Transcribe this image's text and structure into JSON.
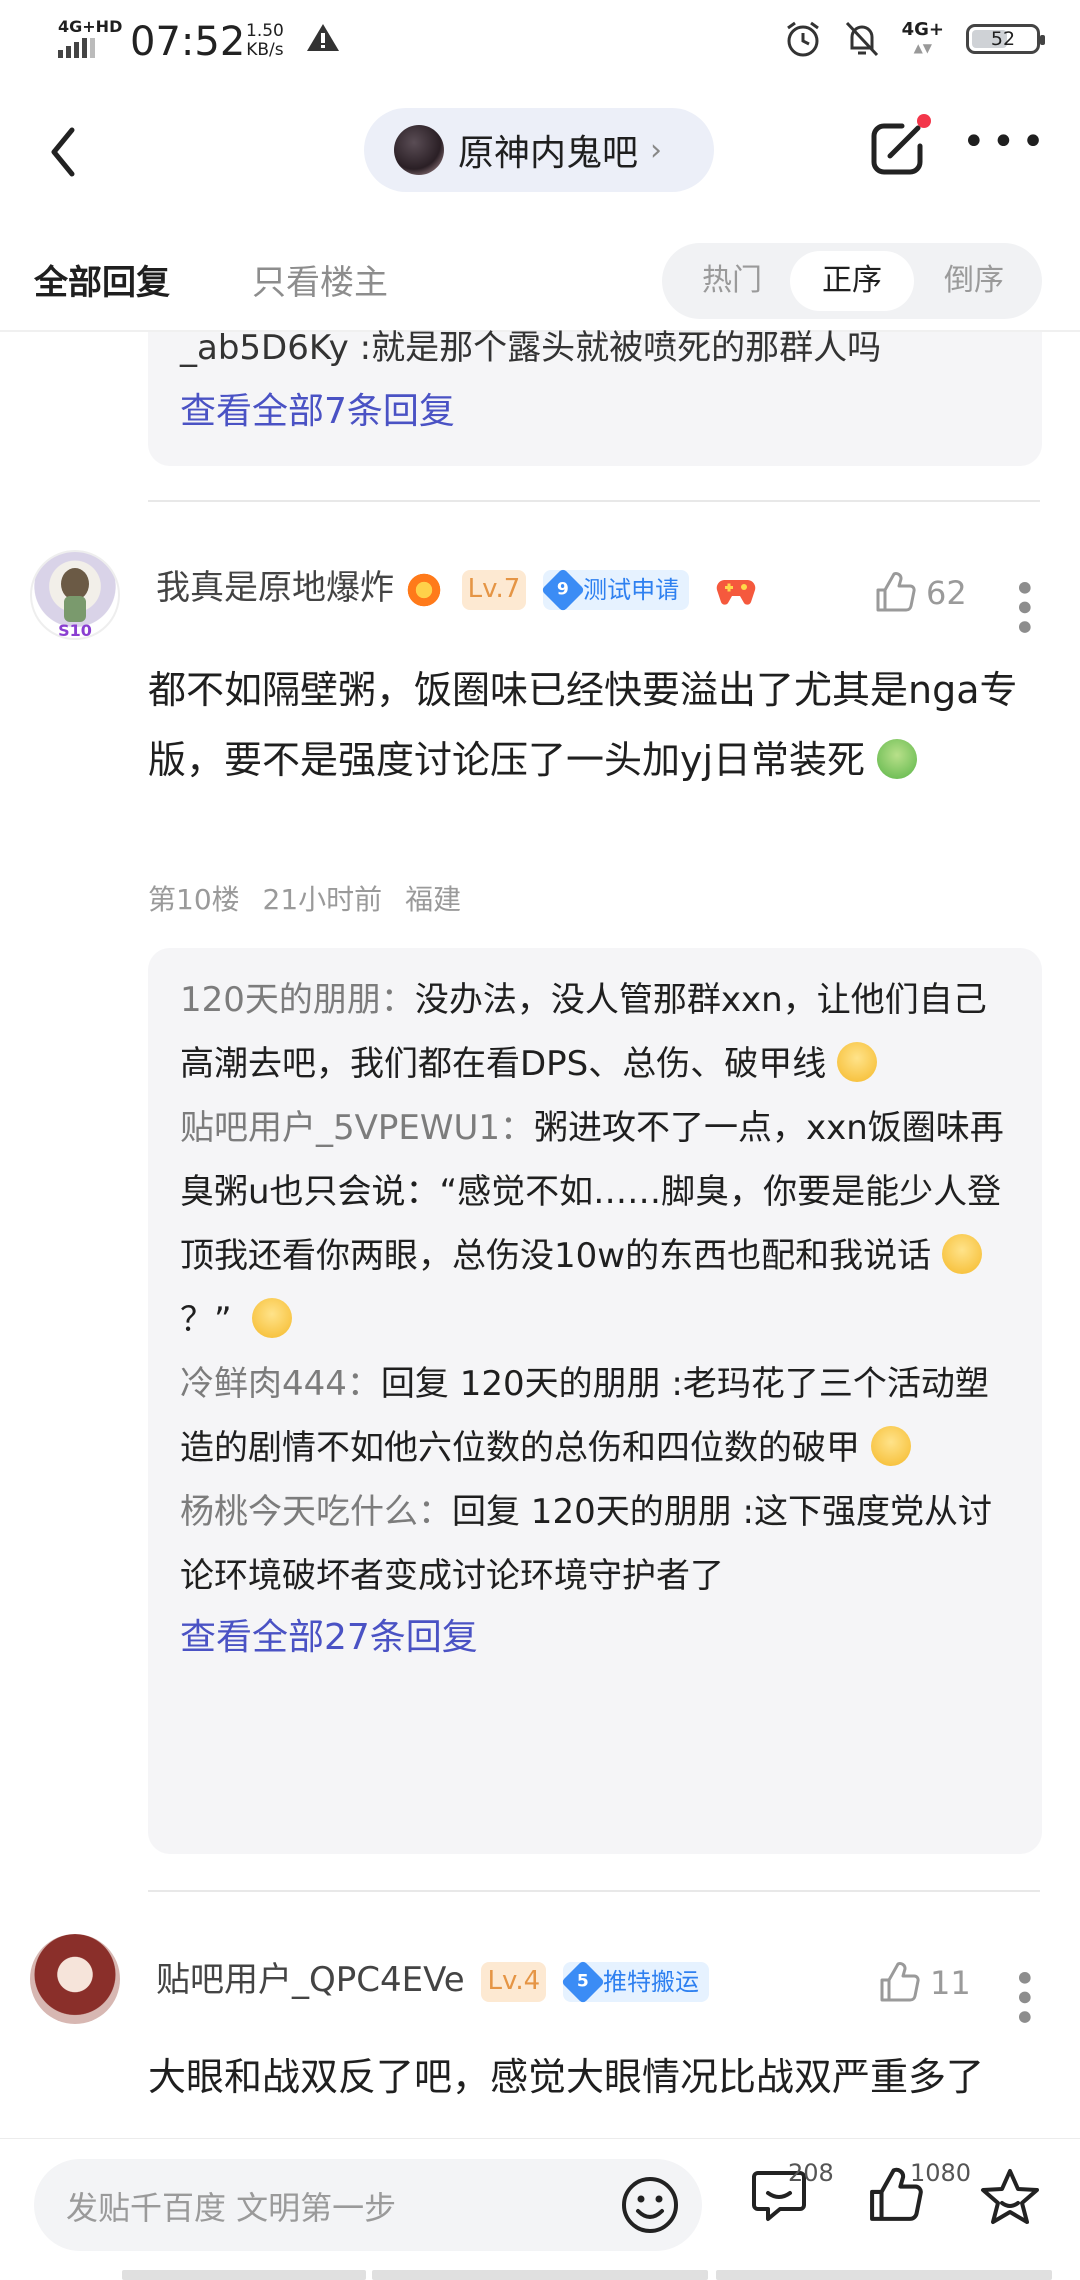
{
  "status": {
    "network": "4G+HD",
    "time": "07:52",
    "rate_value": "1.50",
    "rate_unit": "KB/s",
    "network2": "4G+",
    "battery": "52",
    "battery_level": 0.52
  },
  "header": {
    "forum_name": "原神内鬼吧",
    "forum_chevron": "›"
  },
  "tabs": {
    "all": "全部回复",
    "owner_only": "只看楼主",
    "sort_hot": "热门",
    "sort_asc": "正序",
    "sort_desc": "倒序"
  },
  "prev_block": {
    "reply_text": "_ab5D6Ky :就是那个露头就被喷死的那群人吗",
    "view_all": "查看全部7条回复"
  },
  "post1": {
    "username": "我真是原地爆炸",
    "level": "Lv.7",
    "badge_num": "9",
    "badge_text": "测试申请",
    "likes": "62",
    "avatar_tag": "S10",
    "content": "都不如隔壁粥，饭圈味已经快要溢出了尤其是nga专版，要不是强度讨论压了一头加yj日常装死",
    "floor": "第10楼",
    "time": "21小时前",
    "location": "福建",
    "replies": [
      {
        "user": "120天的朋朋：",
        "text": "没办法，没人管那群xxn，让他们自己高潮去吧，我们都在看DPS、总伤、破甲线"
      },
      {
        "user": "贴吧用户_5VPEWU1：",
        "text": "粥进攻不了一点，xxn饭圈味再臭粥u也只会说：“感觉不如……脚臭，你要是能少人登顶我还看你两眼，总伤没10w的东西也配和我说话",
        "tail": "？”"
      },
      {
        "user": "冷鲜肉444：",
        "text": "回复 120天的朋朋 :老玛花了三个活动塑造的剧情不如他六位数的总伤和四位数的破甲"
      },
      {
        "user": "杨桃今天吃什么：",
        "text": "回复 120天的朋朋 :这下强度党从讨论环境破坏者变成讨论环境守护者了"
      }
    ],
    "view_all": "查看全部27条回复"
  },
  "post2": {
    "username": "贴吧用户_QPC4EVe",
    "level": "Lv.4",
    "badge_num": "5",
    "badge_text": "推特搬运",
    "likes": "11",
    "content": "大眼和战双反了吧，感觉大眼情况比战双严重多了"
  },
  "bottom": {
    "placeholder": "发贴千百度 文明第一步",
    "comments": "208",
    "likes": "1080"
  },
  "colors": {
    "accent": "#4a52c4",
    "badge_blue": "#2e80f0",
    "notif_dot": "#f3364a"
  },
  "icons": [
    "back-icon",
    "chevron-right-icon",
    "compose-icon",
    "more-icon",
    "explosion-icon",
    "gamepad-icon",
    "thumb-up-icon",
    "kebab-icon",
    "smile-icon",
    "comment-icon",
    "star-icon",
    "warning-icon",
    "alarm-icon",
    "mute-icon"
  ]
}
